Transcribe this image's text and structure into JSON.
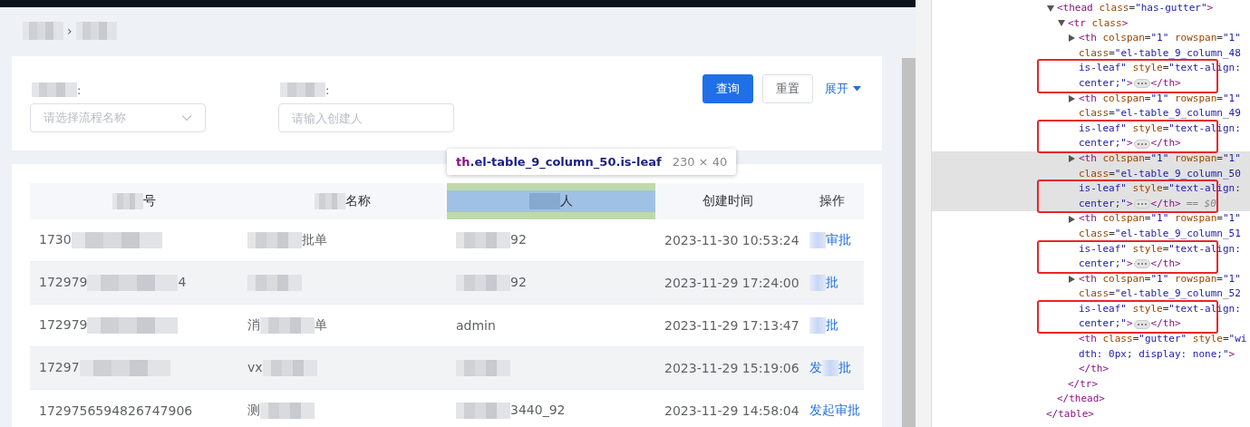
{
  "breadcrumb": [
    {
      "kind": "redacted"
    },
    {
      "kind": "text",
      "text": "›"
    },
    {
      "kind": "redacted"
    }
  ],
  "filters": [
    {
      "kind": "select",
      "label": [
        {
          "kind": "redacted"
        },
        {
          "kind": "text",
          "text": ":"
        }
      ],
      "placeholder": "请选择流程名称"
    },
    {
      "kind": "input",
      "label": [
        {
          "kind": "redacted"
        },
        {
          "kind": "text",
          "text": ":"
        }
      ],
      "placeholder": "请输入创建人"
    }
  ],
  "actions": [
    {
      "kind": "primary",
      "label": "查询"
    },
    {
      "kind": "default",
      "label": "重置"
    },
    {
      "kind": "link",
      "label": "展开"
    }
  ],
  "inspect_tooltip": {
    "tag": "th",
    "selector": ".el-table_9_column_50.is-leaf",
    "size": "230 × 40"
  },
  "table": {
    "columns": [
      {
        "label": [
          {
            "kind": "redacted"
          },
          {
            "kind": "text",
            "text": "号"
          }
        ],
        "highlighted": false
      },
      {
        "label": [
          {
            "kind": "redacted"
          },
          {
            "kind": "text",
            "text": "名称"
          }
        ],
        "highlighted": false
      },
      {
        "label": [
          {
            "kind": "redacted"
          },
          {
            "kind": "text",
            "text": "人"
          }
        ],
        "highlighted": true
      },
      {
        "label": [
          {
            "kind": "text",
            "text": "创建时间"
          }
        ],
        "highlighted": false
      },
      {
        "label": [
          {
            "kind": "text",
            "text": "操作"
          }
        ],
        "highlighted": false
      }
    ],
    "rows": [
      {
        "striped": false,
        "cells": [
          [
            {
              "kind": "text",
              "text": "1730"
            },
            {
              "kind": "redacted"
            }
          ],
          [
            {
              "kind": "redacted"
            },
            {
              "kind": "text",
              "text": "批单"
            }
          ],
          [
            {
              "kind": "redacted"
            },
            {
              "kind": "text",
              "text": "92"
            }
          ],
          [
            {
              "kind": "text",
              "text": "2023-11-30 10:53:24"
            }
          ],
          [
            {
              "kind": "redacted"
            },
            {
              "kind": "text",
              "text": "审批"
            }
          ]
        ]
      },
      {
        "striped": true,
        "cells": [
          [
            {
              "kind": "text",
              "text": "172979"
            },
            {
              "kind": "redacted"
            },
            {
              "kind": "text",
              "text": "4"
            }
          ],
          [
            {
              "kind": "redacted"
            }
          ],
          [
            {
              "kind": "redacted"
            },
            {
              "kind": "text",
              "text": "92"
            }
          ],
          [
            {
              "kind": "text",
              "text": "2023-11-29 17:24:00"
            }
          ],
          [
            {
              "kind": "redacted"
            },
            {
              "kind": "text",
              "text": "批"
            }
          ]
        ]
      },
      {
        "striped": false,
        "cells": [
          [
            {
              "kind": "text",
              "text": "172979"
            },
            {
              "kind": "redacted"
            }
          ],
          [
            {
              "kind": "text",
              "text": "消"
            },
            {
              "kind": "redacted"
            },
            {
              "kind": "text",
              "text": "单"
            }
          ],
          [
            {
              "kind": "text",
              "text": "admin"
            }
          ],
          [
            {
              "kind": "text",
              "text": "2023-11-29 17:13:47"
            }
          ],
          [
            {
              "kind": "redacted"
            },
            {
              "kind": "text",
              "text": "批"
            }
          ]
        ]
      },
      {
        "striped": true,
        "cells": [
          [
            {
              "kind": "text",
              "text": "17297"
            },
            {
              "kind": "redacted"
            }
          ],
          [
            {
              "kind": "text",
              "text": "vx"
            },
            {
              "kind": "redacted"
            }
          ],
          [
            {
              "kind": "redacted"
            }
          ],
          [
            {
              "kind": "text",
              "text": "2023-11-29 15:19:06"
            }
          ],
          [
            {
              "kind": "text",
              "text": "发"
            },
            {
              "kind": "redacted"
            },
            {
              "kind": "text",
              "text": "批"
            }
          ]
        ]
      },
      {
        "striped": false,
        "cells": [
          [
            {
              "kind": "text",
              "text": "1729756594826747906"
            }
          ],
          [
            {
              "kind": "text",
              "text": "测"
            },
            {
              "kind": "redacted"
            }
          ],
          [
            {
              "kind": "redacted"
            },
            {
              "kind": "text",
              "text": "3440_92"
            }
          ],
          [
            {
              "kind": "text",
              "text": "2023-11-29 14:58:04"
            }
          ],
          [
            {
              "kind": "text",
              "text": "发起审批"
            }
          ]
        ]
      }
    ]
  },
  "devtools": {
    "tree": {
      "close": "</table>",
      "children": [
        {
          "lines": [
            "<thead class=\"has-gutter\">"
          ],
          "expandable": true,
          "expanded": true,
          "close": "</thead>",
          "children": [
            {
              "lines": [
                "<tr class>"
              ],
              "expandable": true,
              "expanded": true,
              "close": "</tr>",
              "children": [
                {
                  "lines": [
                    "<th colspan=\"1\" rowspan=\"1\"",
                    "class=\"el-table_9_column_48",
                    "is-leaf\" style=\"text-align:",
                    "center;\">"
                  ],
                  "expandable": true,
                  "expanded": false,
                  "close": "</th>",
                  "selected": false,
                  "annotated": true
                },
                {
                  "lines": [
                    "<th colspan=\"1\" rowspan=\"1\"",
                    "class=\"el-table_9_column_49",
                    "is-leaf\" style=\"text-align:",
                    "center;\">"
                  ],
                  "expandable": true,
                  "expanded": false,
                  "close": "</th>",
                  "selected": false,
                  "annotated": true
                },
                {
                  "lines": [
                    "<th colspan=\"1\" rowspan=\"1\"",
                    "class=\"el-table_9_column_50",
                    "is-leaf\" style=\"text-align:",
                    "center;\">"
                  ],
                  "expandable": true,
                  "expanded": false,
                  "close": "</th>",
                  "selected": true,
                  "console_ref": "== $0",
                  "annotated": true
                },
                {
                  "lines": [
                    "<th colspan=\"1\" rowspan=\"1\"",
                    "class=\"el-table_9_column_51",
                    "is-leaf\" style=\"text-align:",
                    "center;\">"
                  ],
                  "expandable": true,
                  "expanded": false,
                  "close": "</th>",
                  "selected": false,
                  "annotated": true
                },
                {
                  "lines": [
                    "<th colspan=\"1\" rowspan=\"1\"",
                    "class=\"el-table_9_column_52",
                    "is-leaf\" style=\"text-align:",
                    "center;\">"
                  ],
                  "expandable": true,
                  "expanded": false,
                  "close": "</th>",
                  "selected": false,
                  "annotated": true
                },
                {
                  "lines": [
                    "<th class=\"gutter\" style=\"wi",
                    "dth: 0px; display: none;\">"
                  ],
                  "expandable": false,
                  "expanded": false,
                  "close": "</th>",
                  "selected": false,
                  "annotated": false
                }
              ]
            }
          ]
        }
      ]
    }
  }
}
